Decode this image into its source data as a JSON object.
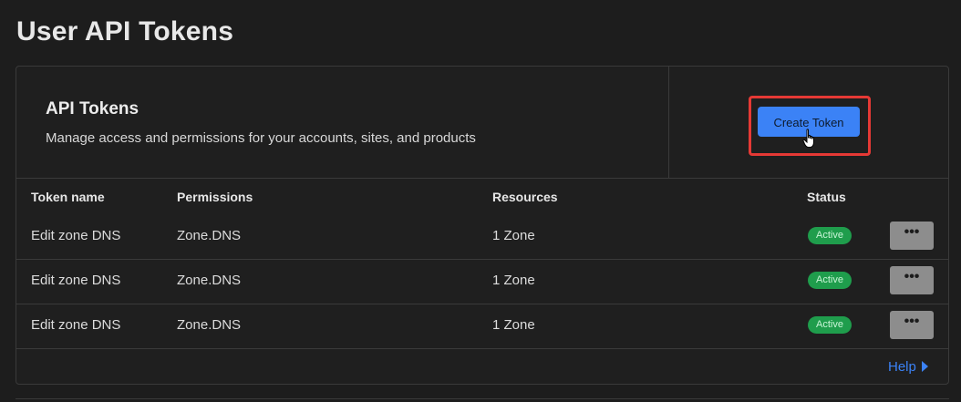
{
  "page": {
    "title": "User API Tokens"
  },
  "card": {
    "title": "API Tokens",
    "subtitle": "Manage access and permissions for your accounts, sites, and products",
    "create_button_label": "Create Token"
  },
  "table": {
    "columns": [
      "Token name",
      "Permissions",
      "Resources",
      "Status"
    ],
    "rows": [
      {
        "name": "Edit zone DNS",
        "permissions": "Zone.DNS",
        "resources": "1 Zone",
        "status": "Active",
        "menu": "•••"
      },
      {
        "name": "Edit zone DNS",
        "permissions": "Zone.DNS",
        "resources": "1 Zone",
        "status": "Active",
        "menu": "•••"
      },
      {
        "name": "Edit zone DNS",
        "permissions": "Zone.DNS",
        "resources": "1 Zone",
        "status": "Active",
        "menu": "•••"
      }
    ]
  },
  "footer": {
    "help_label": "Help"
  },
  "colors": {
    "accent": "#3b82f6",
    "status_active": "#1f9d4c",
    "highlight": "#e53935"
  },
  "icons": {
    "cursor": "hand-pointer-icon",
    "help_arrow": "caret-right-icon",
    "menu": "more-horizontal-icon"
  }
}
